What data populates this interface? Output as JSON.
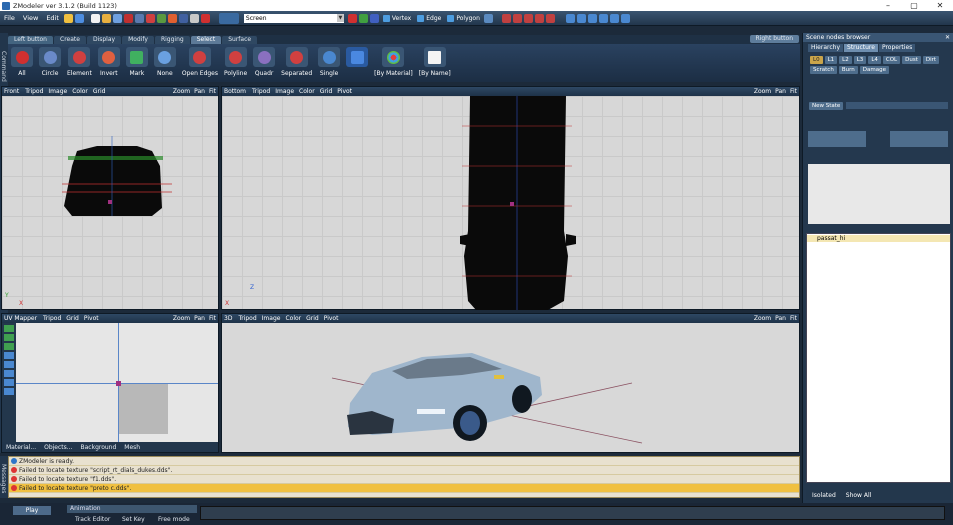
{
  "window": {
    "title": "ZModeler ver 3.1.2 (Build 1123)",
    "min": "–",
    "max": "▢",
    "close": "✕"
  },
  "menu": [
    "File",
    "View",
    "Edit"
  ],
  "toolbar": {
    "screen_label": "Screen",
    "vertex": "Vertex",
    "edge": "Edge",
    "polygon": "Polygon"
  },
  "ribbon": {
    "left_label": "Left button",
    "right_label": "Right button",
    "tabs": [
      "Create",
      "Display",
      "Modify",
      "Rigging",
      "Select",
      "Surface"
    ],
    "active_tab": "Select",
    "buttons": [
      "All",
      "Circle",
      "Element",
      "Invert",
      "Mark",
      "None",
      "Open Edges",
      "Polyline",
      "Quadr",
      "Separated",
      "Single",
      "[By Material]",
      "[By Name]"
    ]
  },
  "command_strip": "Command",
  "viewports": {
    "front": {
      "name": "Front",
      "items": [
        "Tripod",
        "Image",
        "Color",
        "Grid"
      ],
      "right": [
        "Zoom",
        "Pan",
        "Fit"
      ],
      "axes": [
        "Y",
        "X"
      ]
    },
    "bottom": {
      "name": "Bottom",
      "items": [
        "Tripod",
        "Image",
        "Color",
        "Grid",
        "Pivot"
      ],
      "right": [
        "Zoom",
        "Pan",
        "Fit"
      ],
      "axes": [
        "Z",
        "X"
      ]
    },
    "uv": {
      "name": "UV Mapper",
      "items": [
        "Tripod",
        "Grid",
        "Pivot"
      ],
      "right": [
        "Zoom",
        "Pan",
        "Fit"
      ],
      "tabs": [
        "Material...",
        "Objects...",
        "Background",
        "Mesh"
      ]
    },
    "three_d": {
      "name": "3D",
      "items": [
        "Tripod",
        "Image",
        "Color",
        "Grid",
        "Pivot"
      ],
      "right": [
        "Zoom",
        "Pan",
        "Fit"
      ]
    }
  },
  "scene_browser": {
    "title": "Scene nodes browser",
    "tabs": [
      "Hierarchy",
      "Structure",
      "Properties"
    ],
    "active_tab": "Structure",
    "lods": [
      "L0",
      "L1",
      "L2",
      "L3",
      "L4",
      "COL",
      "Dust",
      "Dirt"
    ],
    "lods2": [
      "Scratch",
      "Burn",
      "Damage"
    ],
    "new_state": "New State",
    "node": "passat_hi",
    "footer": {
      "isolated": "Isolated",
      "show_all": "Show All"
    }
  },
  "console": {
    "label": "Messages",
    "messages": [
      {
        "type": "info",
        "text": "ZModeler is ready."
      },
      {
        "type": "err",
        "text": "Failed to locate texture \"script_rt_dials_dukes.dds\"."
      },
      {
        "type": "err",
        "text": "Failed to locate texture \"f1.dds\"."
      },
      {
        "type": "err",
        "text": "Failed to locate texture \"preto c.dds\"."
      }
    ]
  },
  "bottombar": {
    "play": "Play",
    "animation": "Animation",
    "track_editor": "Track Editor",
    "set_key": "Set Key",
    "free_mode": "Free mode"
  }
}
